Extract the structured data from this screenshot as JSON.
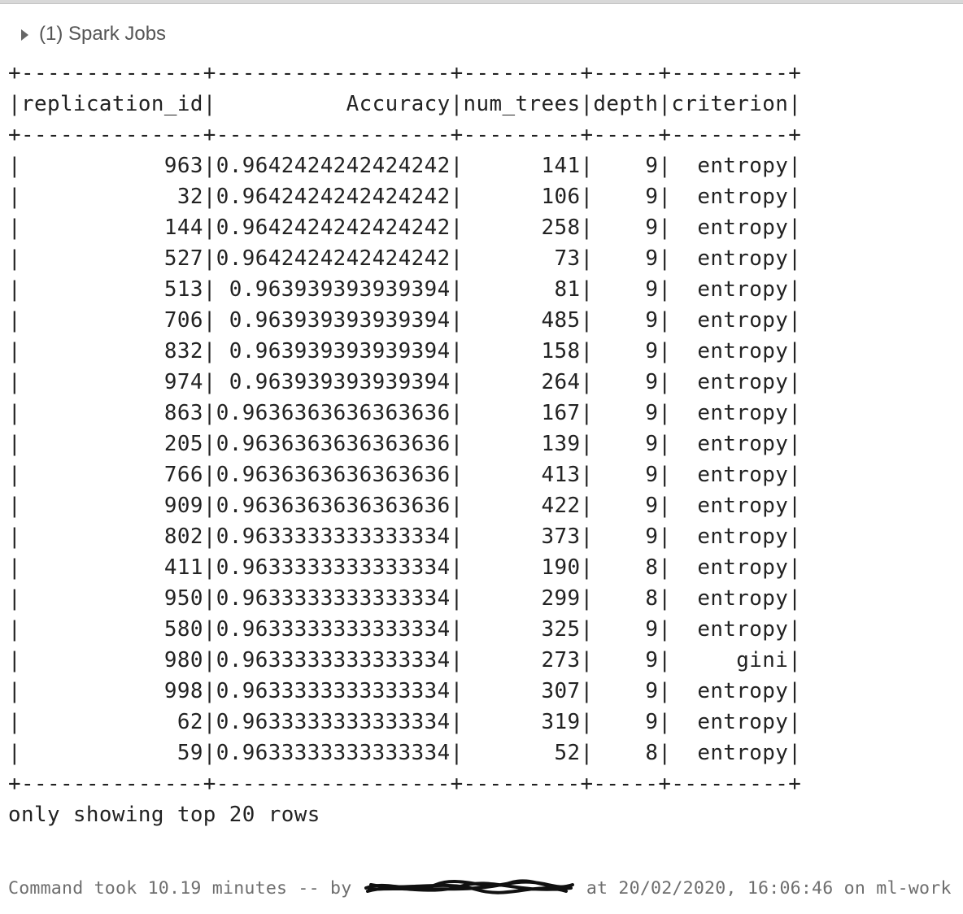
{
  "spark_jobs": {
    "label": "(1) Spark Jobs"
  },
  "table": {
    "border_top": "+--------------+------------------+---------+-----+---------+",
    "border_mid": "+--------------+------------------+---------+-----+---------+",
    "border_bottom": "+--------------+------------------+---------+-----+---------+",
    "headers": [
      "replication_id",
      "Accuracy",
      "num_trees",
      "depth",
      "criterion"
    ],
    "header_line": "|replication_id|          Accuracy|num_trees|depth|criterion|",
    "rows": [
      [
        "963",
        "0.9642424242424242",
        "141",
        "9",
        "entropy"
      ],
      [
        "32",
        "0.9642424242424242",
        "106",
        "9",
        "entropy"
      ],
      [
        "144",
        "0.9642424242424242",
        "258",
        "9",
        "entropy"
      ],
      [
        "527",
        "0.9642424242424242",
        "73",
        "9",
        "entropy"
      ],
      [
        "513",
        "0.963939393939394",
        "81",
        "9",
        "entropy"
      ],
      [
        "706",
        "0.963939393939394",
        "485",
        "9",
        "entropy"
      ],
      [
        "832",
        "0.963939393939394",
        "158",
        "9",
        "entropy"
      ],
      [
        "974",
        "0.963939393939394",
        "264",
        "9",
        "entropy"
      ],
      [
        "863",
        "0.9636363636363636",
        "167",
        "9",
        "entropy"
      ],
      [
        "205",
        "0.9636363636363636",
        "139",
        "9",
        "entropy"
      ],
      [
        "766",
        "0.9636363636363636",
        "413",
        "9",
        "entropy"
      ],
      [
        "909",
        "0.9636363636363636",
        "422",
        "9",
        "entropy"
      ],
      [
        "802",
        "0.9633333333333334",
        "373",
        "9",
        "entropy"
      ],
      [
        "411",
        "0.9633333333333334",
        "190",
        "8",
        "entropy"
      ],
      [
        "950",
        "0.9633333333333334",
        "299",
        "8",
        "entropy"
      ],
      [
        "580",
        "0.9633333333333334",
        "325",
        "9",
        "entropy"
      ],
      [
        "980",
        "0.9633333333333334",
        "273",
        "9",
        "gini"
      ],
      [
        "998",
        "0.9633333333333334",
        "307",
        "9",
        "entropy"
      ],
      [
        "62",
        "0.9633333333333334",
        "319",
        "9",
        "entropy"
      ],
      [
        "59",
        "0.9633333333333334",
        "52",
        "8",
        "entropy"
      ]
    ],
    "footer_note": "only showing top 20 rows"
  },
  "footer": {
    "command_took": "Command took 10.19 minutes -- by",
    "user_redacted_icon": "redacted-scribble-icon",
    "at_text": "at 20/02/2020, 16:06:46 on ml-work"
  },
  "colors": {
    "text": "#222222",
    "muted": "#6e6e6e",
    "spark_jobs": "#555555"
  }
}
